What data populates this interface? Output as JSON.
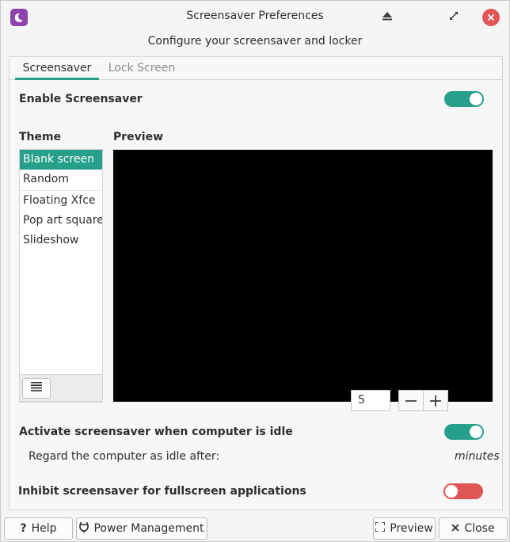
{
  "window": {
    "title": "Screensaver Preferences",
    "subtitle": "Configure your screensaver and locker"
  },
  "tabs": [
    {
      "label": "Screensaver",
      "active": true
    },
    {
      "label": "Lock Screen",
      "active": false
    }
  ],
  "screensaver": {
    "enable_label": "Enable Screensaver",
    "enable_on": true,
    "theme_heading": "Theme",
    "preview_heading": "Preview",
    "themes": [
      "Blank screen",
      "Random",
      "Floating Xfce",
      "Pop art squares",
      "Slideshow"
    ],
    "selected_theme": "Blank screen",
    "activate_label": "Activate screensaver when computer is idle",
    "activate_on": true,
    "idle_label": "Regard the computer as idle after:",
    "idle_value": "5",
    "idle_unit": "minutes",
    "inhibit_label": "Inhibit screensaver for fullscreen applications",
    "inhibit_on": false
  },
  "footer": {
    "help_label": "Help",
    "power_label": "Power Management",
    "preview_label": "Preview",
    "close_label": "Close"
  },
  "colors": {
    "accent": "#26a08b",
    "switch_off": "#e05555",
    "close_button": "#e05555",
    "app_icon": "#8e44ad"
  }
}
